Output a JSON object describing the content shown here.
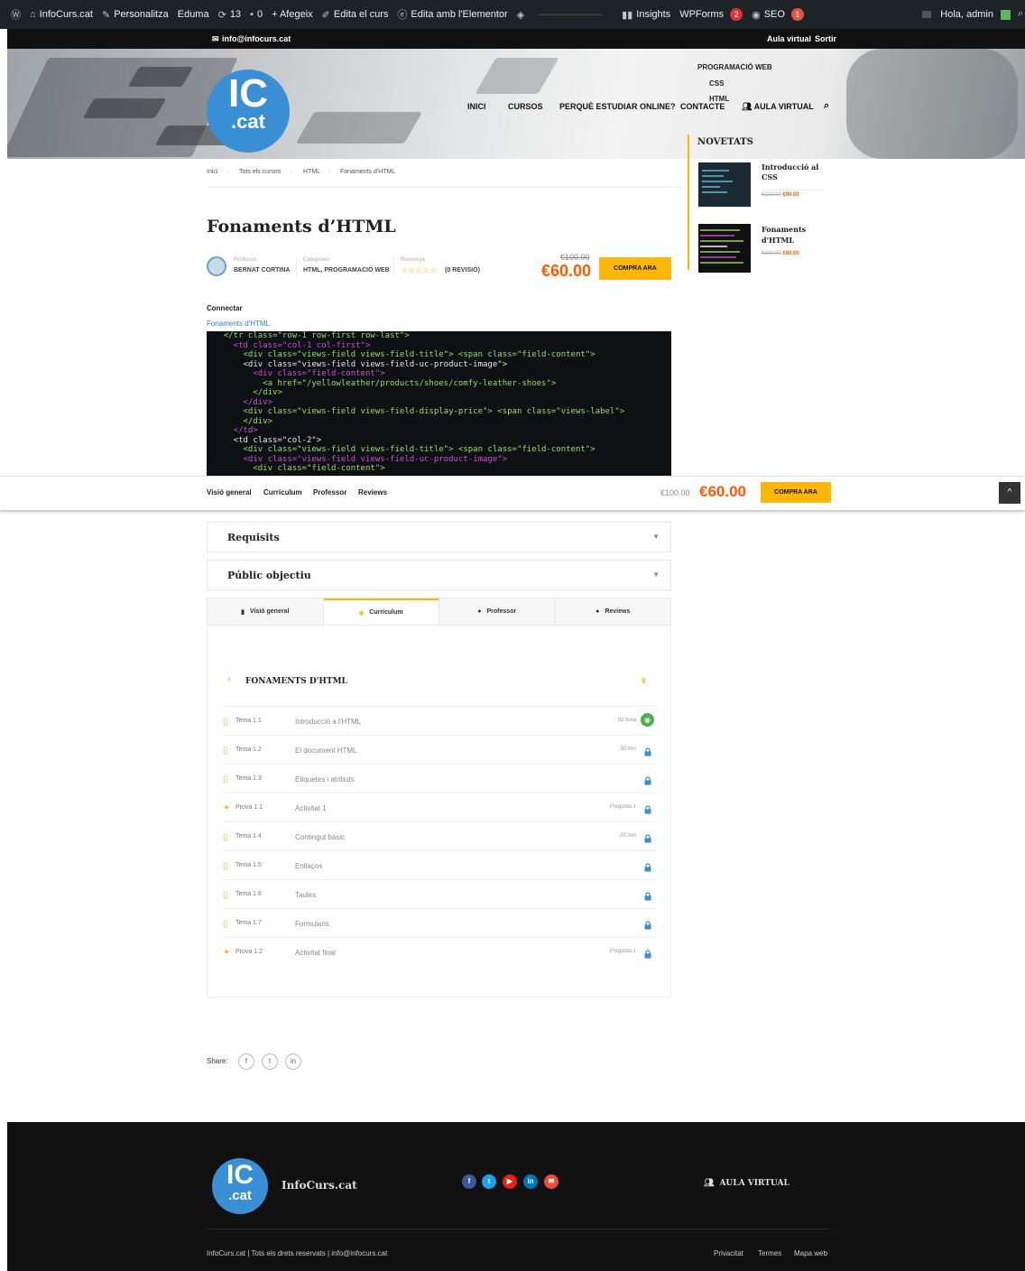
{
  "adminbar": {
    "site": "InfoCurs.cat",
    "customize": "Personalitza",
    "theme": "Eduma",
    "updates": "13",
    "comments": "0",
    "add": "+ Afegeix",
    "edit_course": "Edita el curs",
    "elementor": "Edita amb l'Elementor",
    "insights": "Insights",
    "wpforms": "WPForms",
    "wpforms_count": "2",
    "seo": "SEO",
    "seo_count": "1",
    "greeting": "Hola, admin"
  },
  "topbar": {
    "email": "info@infocurs.cat",
    "virtual": "Aula virtual",
    "logout": "Sortir"
  },
  "logo": {
    "big": "IC",
    "small": ".cat"
  },
  "nav": {
    "home": "INICI",
    "courses": "CURSOS",
    "why": "PERQUÈ ESTUDIAR ONLINE?",
    "contact": "CONTACTE",
    "virtual": "AULA VIRTUAL"
  },
  "dropdown": {
    "group": "PROGRAMACIÓ WEB",
    "css": "CSS",
    "html": "HTML"
  },
  "sidebar": {
    "title": "NOVETATS",
    "items": [
      {
        "title": "Introducció al CSS",
        "old": "€120.00",
        "new": "€90.00"
      },
      {
        "title": "Fonaments d'HTML",
        "old": "€100.00",
        "new": "€60.00"
      }
    ]
  },
  "breadcrumb": {
    "home": "Inici",
    "all": "Tots els cursos",
    "cat": "HTML",
    "current": "Fonaments d'HTML",
    "sep": "›"
  },
  "course": {
    "title": "Fonaments d’HTML",
    "teacher_label": "Professor",
    "teacher": "BERNAT CORTINA",
    "cat_label": "Categories",
    "cats": "HTML, PROGRAMACIÓ WEB",
    "review_label": "Ressenya",
    "stars": "☆☆☆☆☆",
    "reviews": "(0 REVISIÓ)",
    "old_price": "€100.00",
    "price": "€60.00",
    "buy": "COMPRA ARA"
  },
  "connect": {
    "heading": "Connectar",
    "link": "Fonaments d'HTML"
  },
  "code_lines": [
    "  </tr class=\"row-1 row-first row-last\">",
    "    <td class=\"col-1 col-first\">",
    "      <div class=\"views-field views-field-title\"> <span class=\"field-content\">",
    "      <div class=\"views-field views-field-uc-product-image\">",
    "        <div class=\"field-content\">",
    "          <a href=\"/yellowleather/products/shoes/comfy-leather-shoes\">",
    "        </div>",
    "      </div>",
    "      <div class=\"views-field views-field-display-price\"> <span class=\"views-label\">",
    "      </div>",
    "    </td>",
    "    <td class=\"col-2\">",
    "      <div class=\"views-field views-field-title\"> <span class=\"field-content\">",
    "      <div class=\"views-field views-field-uc-product-image\">",
    "        <div class=\"field-content\">"
  ],
  "sticky": {
    "tabs": [
      "Visió general",
      "Currículum",
      "Professor",
      "Reviews"
    ],
    "old": "€100.00",
    "price": "€60.00",
    "buy": "COMPRA ARA",
    "top": "^"
  },
  "accordion": [
    "Requisits",
    "Públic objectiu"
  ],
  "tabs": [
    "Visió general",
    "Currículum",
    "Professor",
    "Reviews"
  ],
  "section": {
    "title": "FONAMENTS D'HTML",
    "count": "9"
  },
  "lessons": [
    {
      "type": "Tema 1.1",
      "name": "Introducció a l'HTML",
      "dur": "01 hora",
      "state": "preview",
      "kind": "doc"
    },
    {
      "type": "Tema 1.2",
      "name": "El document HTML",
      "dur": "30 min",
      "state": "lock",
      "kind": "doc"
    },
    {
      "type": "Tema 1.3",
      "name": "Etiquetes i atributs",
      "dur": "",
      "state": "lock",
      "kind": "doc"
    },
    {
      "type": "Prova 1.1",
      "name": "Activitat 1",
      "dur": "Pregunta 1",
      "state": "lock",
      "kind": "quiz"
    },
    {
      "type": "Tema 1.4",
      "name": "Contingut bàsic",
      "dur": "20 min",
      "state": "lock",
      "kind": "doc"
    },
    {
      "type": "Tema 1.5",
      "name": "Enllaços",
      "dur": "",
      "state": "lock",
      "kind": "doc"
    },
    {
      "type": "Tema 1.6",
      "name": "Taules",
      "dur": "",
      "state": "lock",
      "kind": "doc"
    },
    {
      "type": "Tema 1.7",
      "name": "Formularis",
      "dur": "",
      "state": "lock",
      "kind": "doc"
    },
    {
      "type": "Prova 1.2",
      "name": "Activitat final",
      "dur": "Pregunta 1",
      "state": "lock",
      "kind": "quiz"
    }
  ],
  "share": {
    "label": "Share:",
    "icons": [
      "facebook-icon",
      "twitter-icon",
      "linkedin-icon"
    ]
  },
  "footer": {
    "brand": "InfoCurs.cat",
    "virtual": "AULA VIRTUAL",
    "copyright": "InfoCurs.cat | Tots els drets reservats | info@infocurs.cat",
    "links": [
      "Privacitat",
      "Termes",
      "Mapa web"
    ]
  },
  "colors": {
    "accent": "#ffb606",
    "price": "#ff5a00",
    "brand": "#3a8fd4"
  }
}
